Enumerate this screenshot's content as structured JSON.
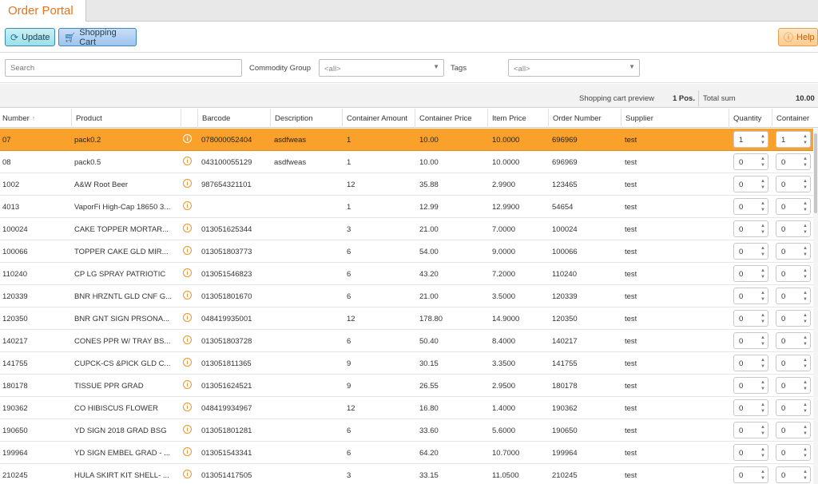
{
  "app": {
    "tab_title": "Order Portal"
  },
  "toolbar": {
    "update_label": "Update",
    "cart_label": "Shopping Cart",
    "help_label": "Help"
  },
  "filters": {
    "search_placeholder": "Search",
    "commodity_label": "Commodity Group",
    "commodity_value": "<all>",
    "tags_label": "Tags",
    "tags_value": "<all>"
  },
  "summary": {
    "preview_label": "Shopping cart preview",
    "positions": "1 Pos.",
    "total_label": "Total sum",
    "total_value": "10.00"
  },
  "columns": {
    "number": "Number",
    "product": "Product",
    "barcode": "Barcode",
    "description": "Description",
    "container_amount": "Container Amount",
    "container_price": "Container Price",
    "item_price": "Item Price",
    "order_number": "Order Number",
    "supplier": "Supplier",
    "quantity": "Quantity",
    "container": "Container"
  },
  "icons": {
    "update": "refresh-icon",
    "cart": "cart-icon",
    "help": "help-icon",
    "info": "info-icon",
    "sort": "sort-up-icon"
  },
  "colors": {
    "accent": "#e8731b",
    "selected_row": "#f9a12a"
  },
  "rows": [
    {
      "number": "07",
      "product": "pack0.2",
      "barcode": "078000052404",
      "description": "asdfweas",
      "container_amount": "1",
      "container_price": "10.00",
      "item_price": "10.0000",
      "order_number": "696969",
      "supplier": "test",
      "quantity": "1",
      "container": "1",
      "selected": true
    },
    {
      "number": "08",
      "product": "pack0.5",
      "barcode": "043100055129",
      "description": "asdfweas",
      "container_amount": "1",
      "container_price": "10.00",
      "item_price": "10.0000",
      "order_number": "696969",
      "supplier": "test",
      "quantity": "0",
      "container": "0"
    },
    {
      "number": "1002",
      "product": "A&W Root Beer",
      "barcode": "987654321101",
      "description": "",
      "container_amount": "12",
      "container_price": "35.88",
      "item_price": "2.9900",
      "order_number": "123465",
      "supplier": "test",
      "quantity": "0",
      "container": "0"
    },
    {
      "number": "4013",
      "product": "VaporFi High-Cap 18650 3...",
      "barcode": "",
      "description": "",
      "container_amount": "1",
      "container_price": "12.99",
      "item_price": "12.9900",
      "order_number": "54654",
      "supplier": "test",
      "quantity": "0",
      "container": "0"
    },
    {
      "number": "100024",
      "product": "CAKE TOPPER MORTAR...",
      "barcode": "013051625344",
      "description": "",
      "container_amount": "3",
      "container_price": "21.00",
      "item_price": "7.0000",
      "order_number": "100024",
      "supplier": "test",
      "quantity": "0",
      "container": "0"
    },
    {
      "number": "100066",
      "product": "TOPPER CAKE GLD MIR...",
      "barcode": "013051803773",
      "description": "",
      "container_amount": "6",
      "container_price": "54.00",
      "item_price": "9.0000",
      "order_number": "100066",
      "supplier": "test",
      "quantity": "0",
      "container": "0"
    },
    {
      "number": "110240",
      "product": "CP LG SPRAY PATRIOTIC",
      "barcode": "013051546823",
      "description": "",
      "container_amount": "6",
      "container_price": "43.20",
      "item_price": "7.2000",
      "order_number": "110240",
      "supplier": "test",
      "quantity": "0",
      "container": "0"
    },
    {
      "number": "120339",
      "product": "BNR HRZNTL GLD CNF G...",
      "barcode": "013051801670",
      "description": "",
      "container_amount": "6",
      "container_price": "21.00",
      "item_price": "3.5000",
      "order_number": "120339",
      "supplier": "test",
      "quantity": "0",
      "container": "0"
    },
    {
      "number": "120350",
      "product": "BNR GNT SIGN PRSONA...",
      "barcode": "048419935001",
      "description": "",
      "container_amount": "12",
      "container_price": "178.80",
      "item_price": "14.9000",
      "order_number": "120350",
      "supplier": "test",
      "quantity": "0",
      "container": "0"
    },
    {
      "number": "140217",
      "product": "CONES PPR W/ TRAY BS...",
      "barcode": "013051803728",
      "description": "",
      "container_amount": "6",
      "container_price": "50.40",
      "item_price": "8.4000",
      "order_number": "140217",
      "supplier": "test",
      "quantity": "0",
      "container": "0"
    },
    {
      "number": "141755",
      "product": "CUPCK-CS &PICK GLD C...",
      "barcode": "013051811365",
      "description": "",
      "container_amount": "9",
      "container_price": "30.15",
      "item_price": "3.3500",
      "order_number": "141755",
      "supplier": "test",
      "quantity": "0",
      "container": "0"
    },
    {
      "number": "180178",
      "product": "TISSUE PPR GRAD",
      "barcode": "013051624521",
      "description": "",
      "container_amount": "9",
      "container_price": "26.55",
      "item_price": "2.9500",
      "order_number": "180178",
      "supplier": "test",
      "quantity": "0",
      "container": "0"
    },
    {
      "number": "190362",
      "product": "CO HIBISCUS FLOWER",
      "barcode": "048419934967",
      "description": "",
      "container_amount": "12",
      "container_price": "16.80",
      "item_price": "1.4000",
      "order_number": "190362",
      "supplier": "test",
      "quantity": "0",
      "container": "0"
    },
    {
      "number": "190650",
      "product": "YD SIGN 2018 GRAD BSG",
      "barcode": "013051801281",
      "description": "",
      "container_amount": "6",
      "container_price": "33.60",
      "item_price": "5.6000",
      "order_number": "190650",
      "supplier": "test",
      "quantity": "0",
      "container": "0"
    },
    {
      "number": "199964",
      "product": "YD SIGN EMBEL GRAD - ...",
      "barcode": "013051543341",
      "description": "",
      "container_amount": "6",
      "container_price": "64.20",
      "item_price": "10.7000",
      "order_number": "199964",
      "supplier": "test",
      "quantity": "0",
      "container": "0"
    },
    {
      "number": "210245",
      "product": "HULA SKIRT KIT SHELL- ...",
      "barcode": "013051417505",
      "description": "",
      "container_amount": "3",
      "container_price": "33.15",
      "item_price": "11.0500",
      "order_number": "210245",
      "supplier": "test",
      "quantity": "0",
      "container": "0"
    }
  ]
}
